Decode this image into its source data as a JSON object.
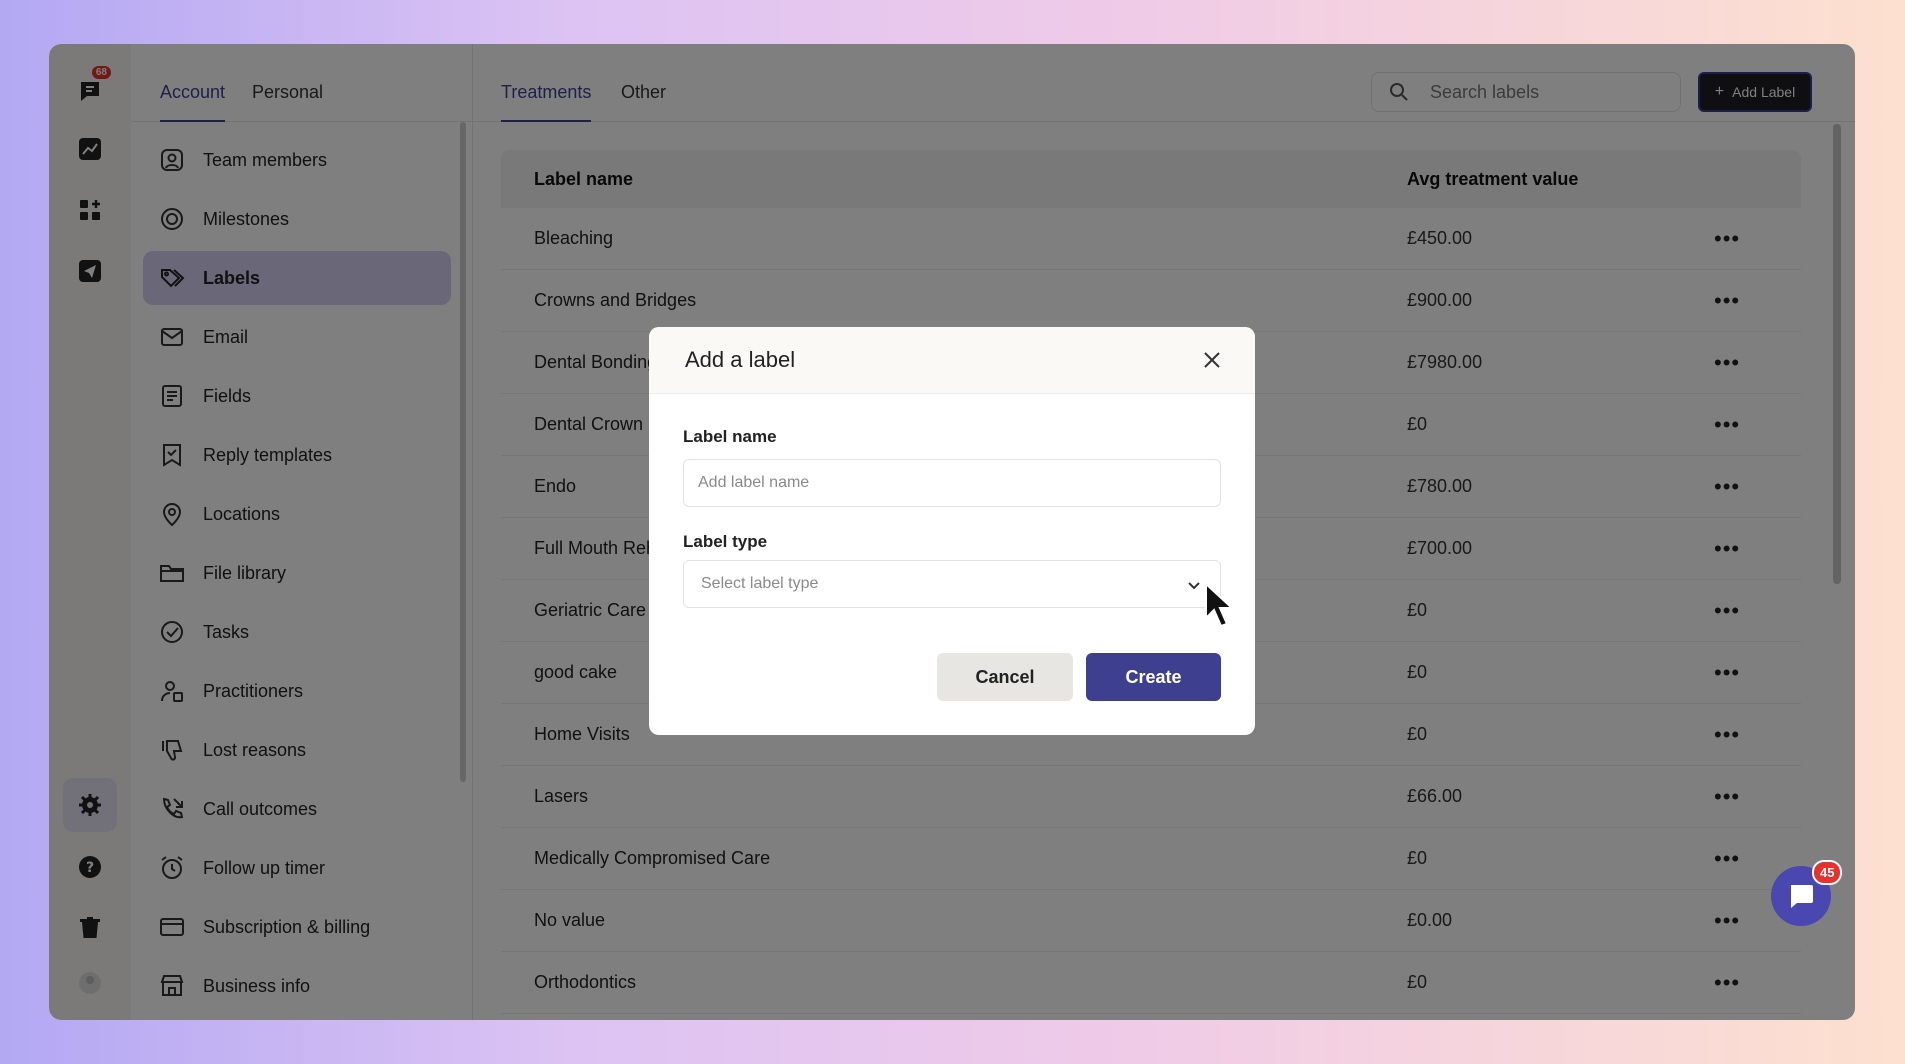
{
  "rail": {
    "logo_badge": "68"
  },
  "settings_tabs": {
    "account": "Account",
    "personal": "Personal"
  },
  "settings_nav": [
    {
      "label": "Team members",
      "icon": "user-square-icon"
    },
    {
      "label": "Milestones",
      "icon": "target-icon"
    },
    {
      "label": "Labels",
      "icon": "tags-icon"
    },
    {
      "label": "Email",
      "icon": "mail-icon"
    },
    {
      "label": "Fields",
      "icon": "fields-icon"
    },
    {
      "label": "Reply templates",
      "icon": "bookmark-icon"
    },
    {
      "label": "Locations",
      "icon": "map-pin-icon"
    },
    {
      "label": "File library",
      "icon": "folder-icon"
    },
    {
      "label": "Tasks",
      "icon": "check-circle-icon"
    },
    {
      "label": "Practitioners",
      "icon": "user-badge-icon"
    },
    {
      "label": "Lost reasons",
      "icon": "thumbs-down-icon"
    },
    {
      "label": "Call outcomes",
      "icon": "phone-outgoing-icon"
    },
    {
      "label": "Follow up timer",
      "icon": "alarm-icon"
    },
    {
      "label": "Subscription & billing",
      "icon": "credit-card-icon"
    },
    {
      "label": "Business info",
      "icon": "store-icon"
    }
  ],
  "main_tabs": {
    "treatments": "Treatments",
    "other": "Other"
  },
  "search": {
    "placeholder": "Search labels"
  },
  "add_label_button": "Add Label",
  "table": {
    "headers": [
      "Label name",
      "Avg treatment value"
    ],
    "rows": [
      [
        "Bleaching",
        "£450.00"
      ],
      [
        "Crowns and Bridges",
        "£900.00"
      ],
      [
        "Dental Bonding",
        "£7980.00"
      ],
      [
        "Dental Crown",
        "£0"
      ],
      [
        "Endo",
        "£780.00"
      ],
      [
        "Full Mouth Rehab",
        "£700.00"
      ],
      [
        "Geriatric Care",
        "£0"
      ],
      [
        "good cake",
        "£0"
      ],
      [
        "Home Visits",
        "£0"
      ],
      [
        "Lasers",
        "£66.00"
      ],
      [
        "Medically Compromised Care",
        "£0"
      ],
      [
        "No value",
        "£0.00"
      ],
      [
        "Orthodontics",
        "£0"
      ]
    ]
  },
  "modal": {
    "title": "Add a label",
    "name_label": "Label name",
    "name_placeholder": "Add label name",
    "type_label": "Label type",
    "type_placeholder": "Select label type",
    "cancel": "Cancel",
    "create": "Create"
  },
  "chat": {
    "badge": "45"
  },
  "colors": {
    "accent": "#3e3f8f",
    "active_nav": "#d4d1f1",
    "badge": "#e5322d",
    "chat": "#4a47b0"
  }
}
